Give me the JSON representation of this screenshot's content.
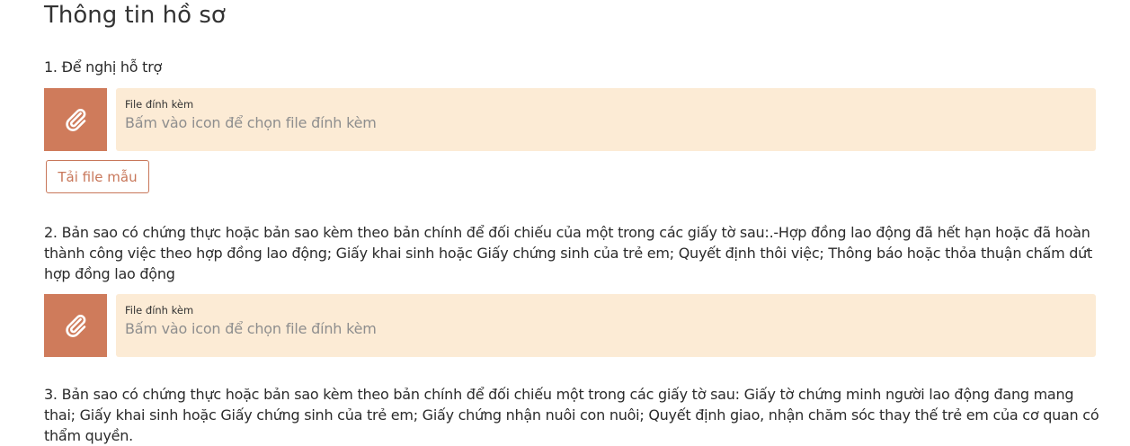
{
  "page": {
    "title": "Thông tin hồ sơ"
  },
  "items": [
    {
      "label": "1. Để nghị hỗ trợ",
      "attachment": {
        "caption": "File đính kèm",
        "placeholder": "Bấm vào icon để chọn file đính kèm"
      },
      "template_button": "Tải file mẫu"
    },
    {
      "label": "2. Bản sao có chứng thực hoặc bản sao kèm theo bản chính để đối chiếu của một trong các giấy tờ sau:.-Hợp đồng lao động đã hết hạn hoặc đã hoàn thành công việc theo hợp đồng lao động; Giấy khai sinh hoặc Giấy chứng sinh của trẻ em; Quyết định thôi việc; Thông báo hoặc thỏa thuận chấm dứt hợp đồng lao động",
      "attachment": {
        "caption": "File đính kèm",
        "placeholder": "Bấm vào icon để chọn file đính kèm"
      }
    },
    {
      "label": "3. Bản sao có chứng thực hoặc bản sao kèm theo bản chính để đối chiếu một trong các giấy tờ sau: Giấy tờ chứng minh người lao động đang mang thai; Giấy khai sinh hoặc Giấy chứng sinh của trẻ em; Giấy chứng nhận nuôi con nuôi; Quyết định giao, nhận chăm sóc thay thế trẻ em của cơ quan có thẩm quyền."
    }
  ],
  "icons": {
    "attach": "paperclip-icon"
  },
  "colors": {
    "accent": "#cf7b5b",
    "field_background": "#fcebd5",
    "placeholder_text": "#8e8e8e"
  }
}
